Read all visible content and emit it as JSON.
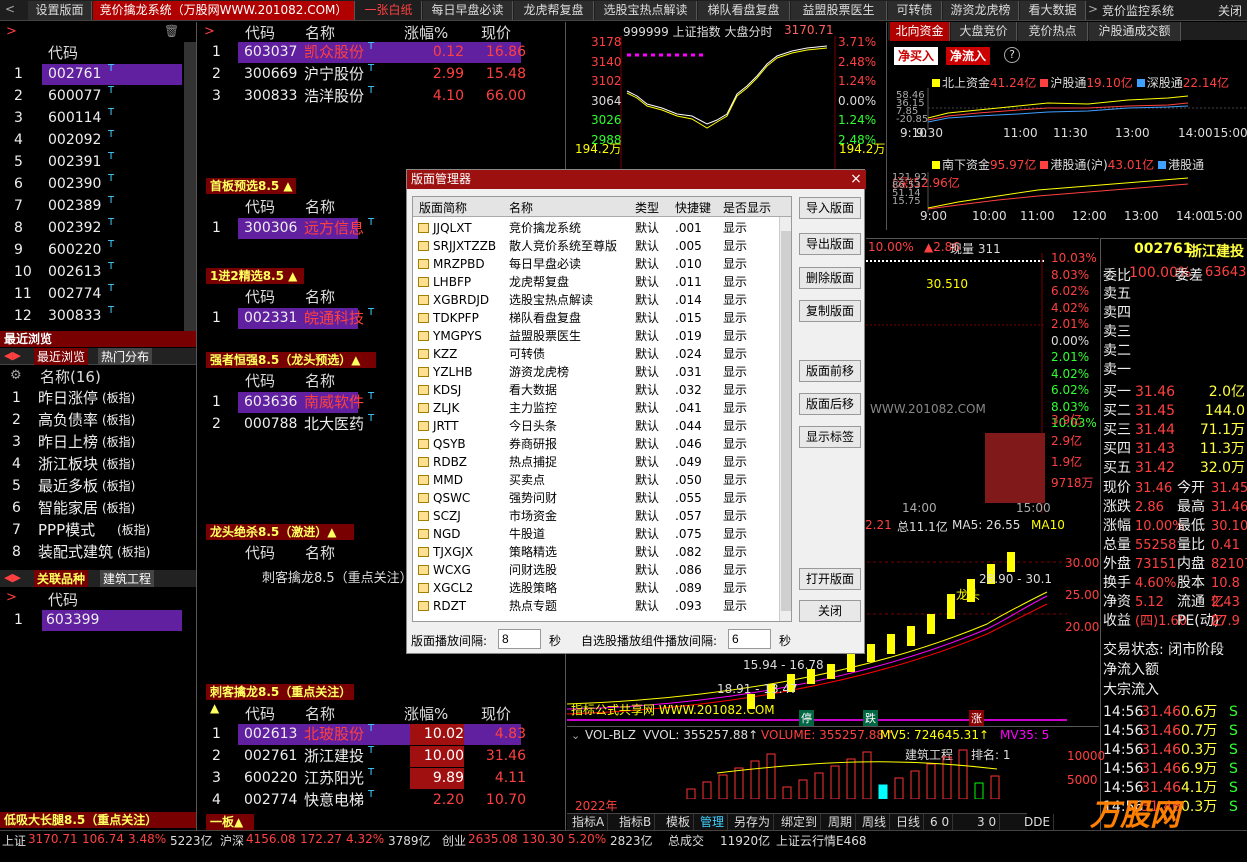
{
  "top_tabs": [
    {
      "label": "设置版面"
    },
    {
      "label": "竞价擒龙系统（万股网WWW.201082.COM）"
    },
    {
      "label": "一张白纸"
    },
    {
      "label": "每日早盘必读"
    },
    {
      "label": "龙虎帮复盘"
    },
    {
      "label": "选股宝热点解读"
    },
    {
      "label": "梯队看盘复盘"
    },
    {
      "label": "益盟股票医生"
    },
    {
      "label": "可转债"
    },
    {
      "label": "游资龙虎榜"
    },
    {
      "label": "看大数据"
    }
  ],
  "app_title": "竞价监控系统",
  "close_label": "关闭",
  "left": {
    "header_code": "代码",
    "codes": [
      "002761",
      "600077",
      "600114",
      "002092",
      "002391",
      "002390",
      "002389",
      "002392",
      "600220",
      "002613",
      "002774",
      "300833"
    ],
    "recent_title": "最近浏览",
    "tabs": [
      "最近浏览",
      "热门分布"
    ],
    "name_header": "名称(16)",
    "sectors": [
      "昨日涨停",
      "高负债率",
      "昨日上榜",
      "浙江板块",
      "最近多板",
      "智能家居",
      "PPP模式",
      "装配式建筑"
    ],
    "sector_suffix": "(板指)",
    "rel_tabs": [
      "关联品种",
      "建筑工程"
    ],
    "rel_code_header": "代码",
    "rel_codes": [
      "603399"
    ],
    "bottom_title": "低吸大长腿8.5（重点关注）"
  },
  "mid": {
    "headers": {
      "code": "代码",
      "name": "名称",
      "pct": "涨幅%",
      "price": "现价"
    },
    "top_rows": [
      {
        "code": "603037",
        "name": "凯众股份",
        "pct": "0.12",
        "price": "16.86"
      },
      {
        "code": "300669",
        "name": "沪宁股份",
        "pct": "2.99",
        "price": "15.48"
      },
      {
        "code": "300833",
        "name": "浩洋股份",
        "pct": "4.10",
        "price": "66.00"
      }
    ],
    "sec1": "首板预选8.5 ▲",
    "sec1_rows": [
      {
        "code": "300306",
        "name": "远方信息"
      }
    ],
    "sec2": "1进2精选8.5 ▲",
    "sec2_rows": [
      {
        "code": "002331",
        "name": "皖通科技"
      }
    ],
    "sec3": "强者恒强8.5（龙头预选）▲",
    "sec3_rows": [
      {
        "code": "603636",
        "name": "南威软件"
      },
      {
        "code": "000788",
        "name": "北大医药"
      }
    ],
    "sec4": "龙头绝杀8.5（激进）▲",
    "sec4_note": "刺客擒龙8.5（重点关注）",
    "sec5": "刺客擒龙8.5（重点关注）▲",
    "sec5_rows": [
      {
        "code": "002613",
        "name": "北玻股份",
        "pct": "10.02",
        "price": "4.83"
      },
      {
        "code": "002761",
        "name": "浙江建投",
        "pct": "10.00",
        "price": "31.46"
      },
      {
        "code": "600220",
        "name": "江苏阳光",
        "pct": "9.89",
        "price": "4.11"
      },
      {
        "code": "002774",
        "name": "快意电梯",
        "pct": "2.20",
        "price": "10.70"
      }
    ],
    "sec6": "一板▲"
  },
  "index_chart": {
    "title": "999999 上证指数  大盘分时",
    "value": "3170.71",
    "left_ticks": [
      "3178",
      "3140",
      "3102",
      "3064",
      "3026",
      "2988"
    ],
    "right_ticks": [
      "3.71%",
      "2.48%",
      "1.24%",
      "0.00%",
      "1.24%",
      "2.48%"
    ],
    "vol": "194.2万"
  },
  "north": {
    "tabs": [
      "北向资金",
      "大盘竞价",
      "竞价热点",
      "沪股通成交额"
    ],
    "btns": [
      "净买入",
      "净流入"
    ],
    "legend1": [
      {
        "label": "北上资金",
        "value": "41.24亿"
      },
      {
        "label": "沪股通",
        "value": "19.10亿"
      },
      {
        "label": "深股通",
        "value": "22.14亿"
      }
    ],
    "ticks1": [
      "58.46",
      "36.15",
      "7.85",
      "-20.85"
    ],
    "times1": [
      "9:10",
      "9:30",
      "11:00",
      "11:30",
      "13:00",
      "14:00",
      "15:00"
    ],
    "legend2": [
      {
        "label": "南下资金",
        "value": "95.97亿"
      },
      {
        "label": "港股通(沪)",
        "value": "43.01亿"
      },
      {
        "label": "港股通",
        "value": ""
      }
    ],
    "legend2b": "(深)52.96亿",
    "ticks2": [
      "121.92",
      "86.53",
      "51.14",
      "15.75"
    ],
    "times2": [
      "9:00",
      "10:00",
      "11:00",
      "12:00",
      "13:00",
      "14:00",
      "15:00"
    ]
  },
  "quote": {
    "code": "002761",
    "name": "浙江建投",
    "weibi": "委比",
    "weibi_val": "100.00%",
    "weicha": "委差",
    "weicha_val": "63643",
    "sells": [
      "卖五",
      "卖四",
      "卖三",
      "卖二",
      "卖一"
    ],
    "buys": [
      {
        "label": "买一",
        "price": "31.46",
        "vol": "2.0亿"
      },
      {
        "label": "买二",
        "price": "31.45",
        "vol": "144.0万"
      },
      {
        "label": "买三",
        "price": "31.44",
        "vol": "71.1万"
      },
      {
        "label": "买四",
        "price": "31.43",
        "vol": "11.3万"
      },
      {
        "label": "买五",
        "price": "31.42",
        "vol": "32.0万"
      }
    ],
    "stats": [
      {
        "l1": "现价",
        "v1": "31.46",
        "l2": "今开",
        "v2": "31.45"
      },
      {
        "l1": "涨跌",
        "v1": "2.86",
        "l2": "最高",
        "v2": "31.46"
      },
      {
        "l1": "涨幅",
        "v1": "10.00%",
        "l2": "最低",
        "v2": "30.10"
      },
      {
        "l1": "总量",
        "v1": "55258",
        "l2": "量比",
        "v2": "0.41"
      },
      {
        "l1": "外盘",
        "v1": "73151",
        "l2": "内盘",
        "v2": "82107"
      },
      {
        "l1": "换手",
        "v1": "4.60%",
        "l2": "股本",
        "v2": "10.8亿"
      },
      {
        "l1": "净资",
        "v1": "5.12",
        "l2": "流通",
        "v2": "2.43亿"
      },
      {
        "l1": "收益",
        "v1": "(四)1.60",
        "l2": "PE(动)",
        "v2": "27.9"
      }
    ],
    "trade_state": "交易状态: 闭市阶段",
    "flow1": "净流入额",
    "flow2": "大宗流入",
    "ticks": [
      {
        "t": "14:56",
        "p": "31.46",
        "v": "0.6万",
        "s": "S"
      },
      {
        "t": "14:56",
        "p": "31.46",
        "v": "0.7万",
        "s": "S"
      },
      {
        "t": "14:56",
        "p": "31.46",
        "v": "0.3万",
        "s": "S"
      },
      {
        "t": "14:56",
        "p": "31.46",
        "v": "6.9万",
        "s": "S"
      },
      {
        "t": "14:56",
        "p": "31.46",
        "v": "4.1万",
        "s": "S"
      },
      {
        "t": "14:56",
        "p": "31.46",
        "v": "0.3万",
        "s": "S"
      }
    ]
  },
  "intraday": {
    "pct_label": "10.00%",
    "chg": "▲2.86",
    "vol_label": "现量 311",
    "right_ticks": [
      "10.03%",
      "8.03%",
      "6.02%",
      "4.02%",
      "2.01%",
      "0.00%",
      "2.01%",
      "4.02%",
      "6.02%",
      "8.03%",
      "10.03%"
    ],
    "vol_ticks": [
      "3.9亿",
      "2.9亿",
      "1.9亿",
      "9718万"
    ],
    "watermark": "WWW.201082.COM",
    "time_labels": [
      "14:00",
      "15:00"
    ],
    "crosshair": "30.510"
  },
  "kline": {
    "ma5": "MA5: 26.55",
    "ma10": "MA10",
    "info1": "2.21",
    "info2": "总11.1亿",
    "dragon": "龙头",
    "price_ticks": [
      "30.00",
      "25.00",
      "20.00"
    ],
    "label1": "28.90 - 30.1",
    "label2": "15.94 - 16.78",
    "label3": "18.91 - 13.47",
    "bottom_note": "指标公式共享网 WWW.201082.COM",
    "markers": [
      "停",
      "跌",
      "涨"
    ]
  },
  "vol_panel": {
    "title": "VOL-BLZ",
    "vvol": "VVOL: 355257.88↑",
    "volume": "VOLUME: 355257.88↑",
    "mv5": "MV5: 724645.31↑",
    "mv35": "MV35: 5",
    "sector": "建筑工程",
    "rank": "排名: 1",
    "ticks": [
      "10000",
      "5000"
    ],
    "year": "2022年"
  },
  "tool_tabs": [
    "指标A",
    "指标B",
    "模板",
    "管理",
    "另存为",
    "绑定到",
    "周期",
    "周线",
    "日线",
    "6 0",
    "3 0",
    "DDE决策"
  ],
  "statusbar": [
    {
      "label": "上证",
      "a": "3170.71",
      "b": "106.74",
      "c": "3.48%",
      "d": "5223亿"
    },
    {
      "label": "沪深",
      "a": "4156.08",
      "b": "172.27",
      "c": "4.32%",
      "d": "3789亿"
    },
    {
      "label": "创业",
      "a": "2635.08",
      "b": "130.30",
      "c": "5.20%",
      "d": "2823亿"
    }
  ],
  "status_extra": [
    "总成交",
    "11920亿",
    "上证云行情E468"
  ],
  "dialog": {
    "title": "版面管理器",
    "headers": [
      "版面简称",
      "名称",
      "类型",
      "快捷键",
      "是否显示"
    ],
    "rows": [
      [
        "JJQLXT",
        "竞价擒龙系统",
        "默认",
        ".001",
        "显示"
      ],
      [
        "SRJJXTZZB",
        "散人竞价系统至尊版",
        "默认",
        ".005",
        "显示"
      ],
      [
        "MRZPBD",
        "每日早盘必读",
        "默认",
        ".010",
        "显示"
      ],
      [
        "LHBFP",
        "龙虎帮复盘",
        "默认",
        ".011",
        "显示"
      ],
      [
        "XGBRDJD",
        "选股宝热点解读",
        "默认",
        ".014",
        "显示"
      ],
      [
        "TDKPFP",
        "梯队看盘复盘",
        "默认",
        ".015",
        "显示"
      ],
      [
        "YMGPYS",
        "益盟股票医生",
        "默认",
        ".019",
        "显示"
      ],
      [
        "KZZ",
        "可转债",
        "默认",
        ".024",
        "显示"
      ],
      [
        "YZLHB",
        "游资龙虎榜",
        "默认",
        ".031",
        "显示"
      ],
      [
        "KDSJ",
        "看大数据",
        "默认",
        ".032",
        "显示"
      ],
      [
        "ZLJK",
        "主力监控",
        "默认",
        ".041",
        "显示"
      ],
      [
        "JRTT",
        "今日头条",
        "默认",
        ".044",
        "显示"
      ],
      [
        "QSYB",
        "券商研报",
        "默认",
        ".046",
        "显示"
      ],
      [
        "RDBZ",
        "热点捕捉",
        "默认",
        ".049",
        "显示"
      ],
      [
        "MMD",
        "买卖点",
        "默认",
        ".050",
        "显示"
      ],
      [
        "QSWC",
        "强势问财",
        "默认",
        ".055",
        "显示"
      ],
      [
        "SCZJ",
        "市场资金",
        "默认",
        ".057",
        "显示"
      ],
      [
        "NGD",
        "牛股道",
        "默认",
        ".075",
        "显示"
      ],
      [
        "TJXGJX",
        "策略精选",
        "默认",
        ".082",
        "显示"
      ],
      [
        "WCXG",
        "问财选股",
        "默认",
        ".086",
        "显示"
      ],
      [
        "XGCL2",
        "选股策略",
        "默认",
        ".089",
        "显示"
      ],
      [
        "RDZT",
        "热点专题",
        "默认",
        ".093",
        "显示"
      ]
    ],
    "buttons": [
      "导入版面",
      "导出版面",
      "删除版面",
      "复制版面",
      "版面前移",
      "版面后移",
      "显示标签",
      "打开版面",
      "关闭"
    ],
    "interval_label": "版面播放间隔:",
    "interval_value": "8",
    "sec1": "秒",
    "widget_label": "自选股播放组件播放间隔:",
    "widget_value": "6",
    "sec2": "秒"
  },
  "logo_text": "万股网"
}
